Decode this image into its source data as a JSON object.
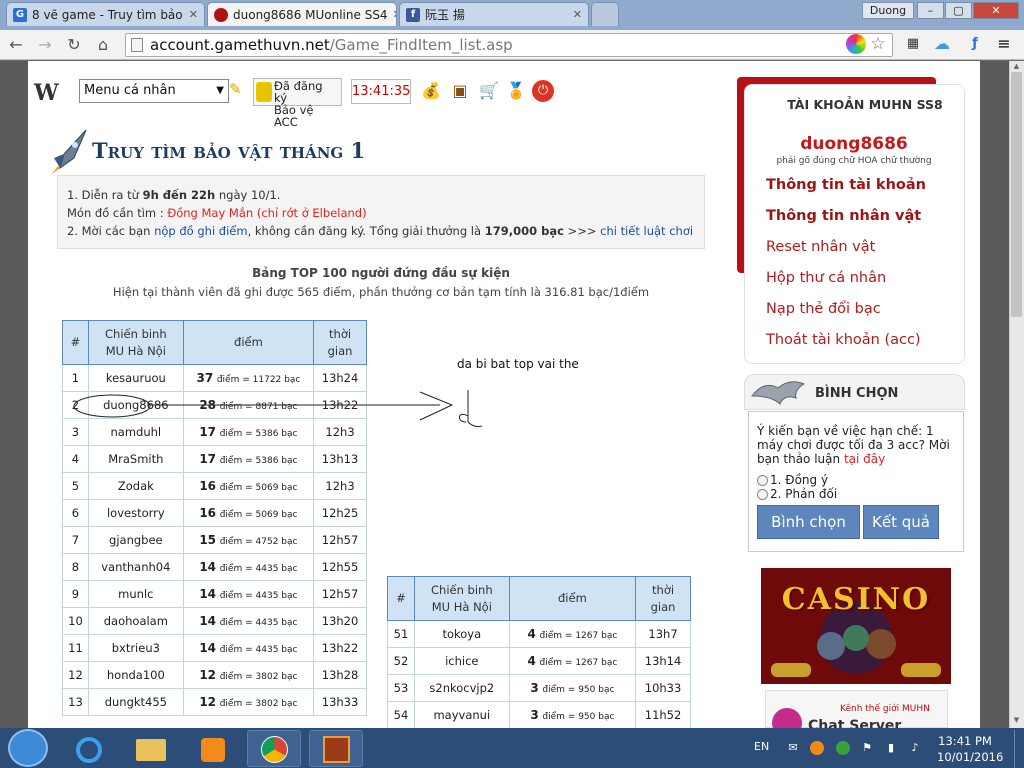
{
  "browser": {
    "tabs": [
      {
        "label": "8 vẽ game - Truy tìm bảo",
        "favicon": "G",
        "favicon_color": "#2a6fd6"
      },
      {
        "label": "duong8686 MUonline SS4",
        "favicon": "",
        "favicon_color": "#b11212"
      },
      {
        "label": "阮玉 揚",
        "favicon": "f",
        "favicon_color": "#3b5998"
      }
    ],
    "profile": "Duong",
    "url_host": "account.gamethuvn.net",
    "url_path": "/Game_FindItem_list.asp"
  },
  "toolbar": {
    "menu_label": "Menu cá nhân",
    "reg_line1": "Đã đăng ký",
    "reg_line2": "Bảo vệ ACC",
    "clock": "13:41:35"
  },
  "heading": {
    "title_a": "Truy tìm bảo vật tháng",
    "title_num": "1"
  },
  "info": {
    "l1_a": "1. Diễn ra từ ",
    "l1_b": "9h đến 22h",
    "l1_c": " ngày 10/1.",
    "l2_a": "Món đồ cần tìm : ",
    "l2_b": "Đồng May Mắn (chỉ rớt ở Elbeland)",
    "l3_a": "2. Mời các bạn ",
    "l3_link": "nộp đồ ghi điểm",
    "l3_b": ", không cần đăng ký. Tổng giải thưởng là ",
    "l3_amount": "179,000 bạc",
    "l3_c": " >>> ",
    "l3_link2": "chi tiết luật chơi"
  },
  "top": {
    "title": "Bảng TOP 100 người đứng đầu sự kiện",
    "sub": "Hiện tại thành viên đã ghi được 565 điểm, phần thưởng cơ bản tạm tính là 316.81 bạc/1điểm"
  },
  "table_head": {
    "num": "#",
    "player_l1": "Chiến binh",
    "player_l2": "MU Hà Nội",
    "points": "điểm",
    "time_l1": "thời",
    "time_l2": "gian"
  },
  "units": {
    "diem": "điểm",
    "bac": "bạc",
    "eq": "="
  },
  "rows_left": [
    {
      "n": "1",
      "name": "kesauruou",
      "pts": "37",
      "bac": "11722",
      "t": "13h24"
    },
    {
      "n": "2",
      "name": "duong8686",
      "pts": "28",
      "bac": "8871",
      "t": "13h22"
    },
    {
      "n": "3",
      "name": "namduhl",
      "pts": "17",
      "bac": "5386",
      "t": "12h3"
    },
    {
      "n": "4",
      "name": "MraSmith",
      "pts": "17",
      "bac": "5386",
      "t": "13h13"
    },
    {
      "n": "5",
      "name": "Zodak",
      "pts": "16",
      "bac": "5069",
      "t": "12h3"
    },
    {
      "n": "6",
      "name": "lovestorry",
      "pts": "16",
      "bac": "5069",
      "t": "12h25"
    },
    {
      "n": "7",
      "name": "gjangbee",
      "pts": "15",
      "bac": "4752",
      "t": "12h57"
    },
    {
      "n": "8",
      "name": "vanthanh04",
      "pts": "14",
      "bac": "4435",
      "t": "12h55"
    },
    {
      "n": "9",
      "name": "munlc",
      "pts": "14",
      "bac": "4435",
      "t": "12h57"
    },
    {
      "n": "10",
      "name": "daohoalam",
      "pts": "14",
      "bac": "4435",
      "t": "13h20"
    },
    {
      "n": "11",
      "name": "bxtrieu3",
      "pts": "14",
      "bac": "4435",
      "t": "13h22"
    },
    {
      "n": "12",
      "name": "honda100",
      "pts": "12",
      "bac": "3802",
      "t": "13h28"
    },
    {
      "n": "13",
      "name": "dungkt455",
      "pts": "12",
      "bac": "3802",
      "t": "13h33"
    }
  ],
  "rows_right": [
    {
      "n": "51",
      "name": "tokoya",
      "pts": "4",
      "bac": "1267",
      "t": "13h7"
    },
    {
      "n": "52",
      "name": "ichice",
      "pts": "4",
      "bac": "1267",
      "t": "13h14"
    },
    {
      "n": "53",
      "name": "s2nkocvjp2",
      "pts": "3",
      "bac": "950",
      "t": "10h33"
    },
    {
      "n": "54",
      "name": "mayvanui",
      "pts": "3",
      "bac": "950",
      "t": "11h52"
    }
  ],
  "annotation": "da bi bat top vai the",
  "sidebar": {
    "title": "TÀI KHOẢN MUHN SS8",
    "username": "duong8686",
    "note": "phải gõ đúng chữ HOA chữ thường",
    "links": [
      {
        "label": "Thông tin tài khoản",
        "bold": true
      },
      {
        "label": "Thông tin nhân vật",
        "bold": true
      },
      {
        "label": "Reset nhân vật",
        "bold": false
      },
      {
        "label": "Hộp thư cá nhân",
        "bold": false
      },
      {
        "label": "Nạp thẻ đổi bạc",
        "bold": false
      },
      {
        "label": "Thoát tài khoản (acc)",
        "bold": false
      }
    ],
    "vote_title": "BÌNH CHỌN",
    "vote_q": "Ý kiến bạn về việc hạn chế: 1 máy chơi được tối đa 3 acc? Mời bạn thảo luận ",
    "vote_link": "tại đây",
    "vote_opt1": "1. Đồng ý",
    "vote_opt2": "2. Phản đối",
    "vote_btn": "Bình chọn",
    "result_btn": "Kết quả",
    "ad_casino": "CASINO",
    "ad_kenh": "Kênh thế giới MUHN",
    "ad_chat": "Chat Server"
  },
  "taskbar": {
    "lang": "EN",
    "time": "13:41 PM",
    "date": "10/01/2016"
  },
  "colors": {
    "accent_red": "#b61116",
    "link_blue": "#1a4fa0",
    "table_head": "#cfe3f5"
  }
}
